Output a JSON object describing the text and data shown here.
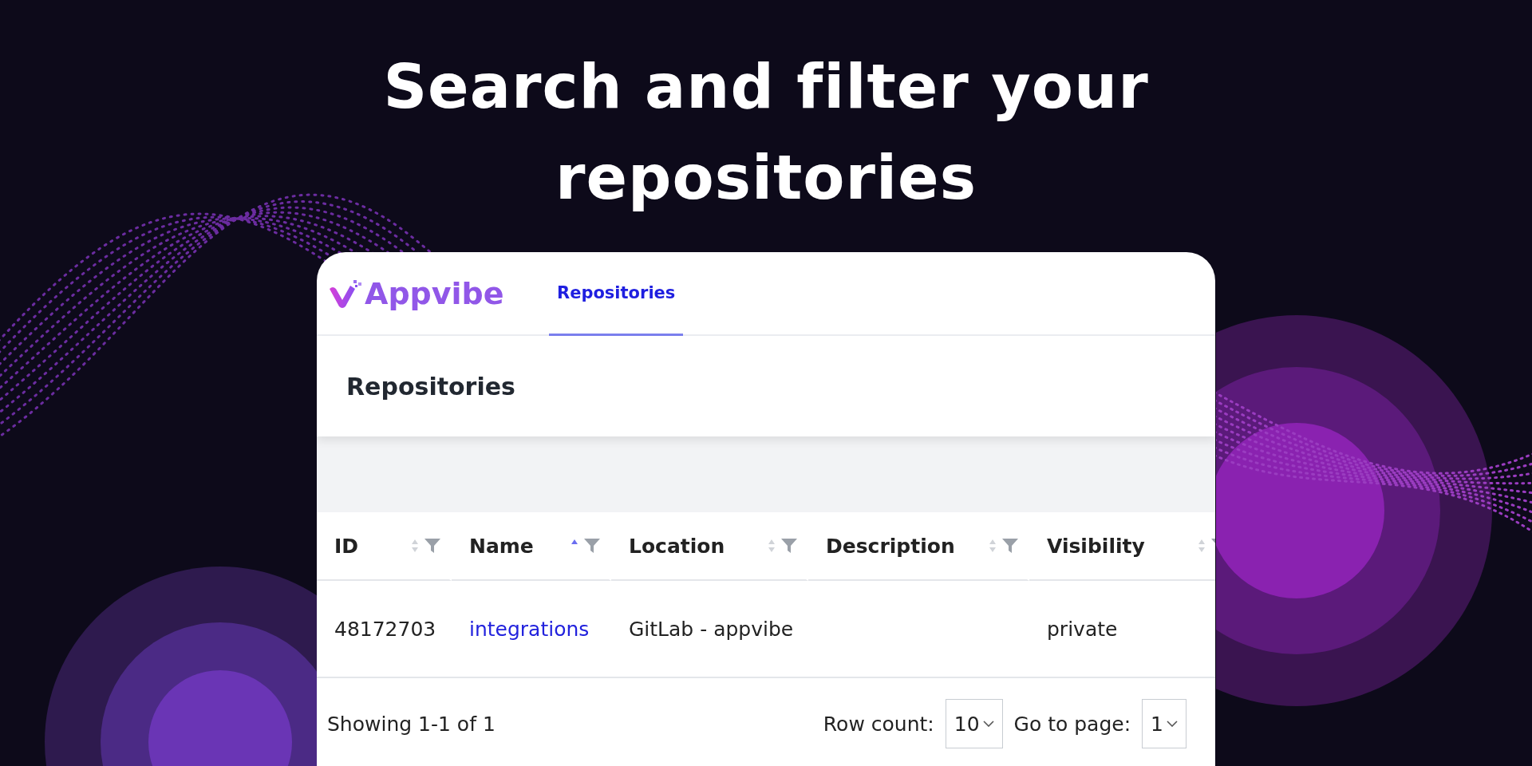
{
  "headline": {
    "lines": [
      "Search and filter your",
      "repositories"
    ]
  },
  "app": {
    "brand": "Appvibe",
    "nav_tabs": [
      {
        "label": "Repositories",
        "selected": true
      }
    ],
    "page_title": "Repositories",
    "table": {
      "columns": [
        {
          "label": "ID",
          "sorted_ascending": false
        },
        {
          "label": "Name",
          "sorted_ascending": true
        },
        {
          "label": "Location",
          "sorted_ascending": false
        },
        {
          "label": "Description",
          "sorted_ascending": false
        },
        {
          "label": "Visibility",
          "sorted_ascending": false
        }
      ],
      "rows": [
        {
          "id": "48172703",
          "name": "integrations",
          "location": "GitLab - appvibe",
          "visibility": "private"
        }
      ]
    },
    "footer": {
      "summary": "Showing 1-1 of 1",
      "row_count": {
        "label": "Row count:",
        "value": "10"
      },
      "page": {
        "label": "Go to page:",
        "value": "1"
      }
    }
  }
}
